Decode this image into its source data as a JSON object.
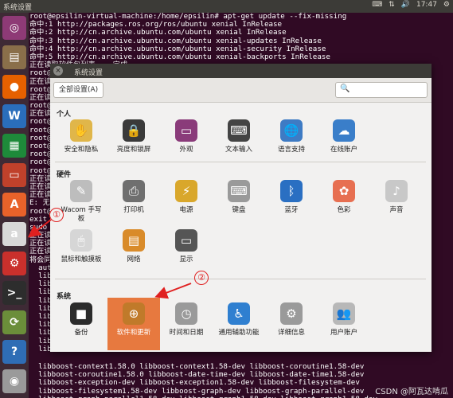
{
  "topbar": {
    "title": "系统设置",
    "time": "17:47",
    "icons": [
      "keyboard-icon",
      "network-icon",
      "sound-icon",
      "power-icon"
    ]
  },
  "launcher": {
    "items": [
      {
        "name": "ubuntu-dash-icon",
        "color": "#8e3a76",
        "glyph": "◎"
      },
      {
        "name": "files-icon",
        "color": "#8a6f4a",
        "glyph": "▤"
      },
      {
        "name": "firefox-icon",
        "color": "#e66000",
        "glyph": "●"
      },
      {
        "name": "writer-icon",
        "color": "#2a6ebb",
        "glyph": "W"
      },
      {
        "name": "calc-icon",
        "color": "#1e8a3a",
        "glyph": "▦"
      },
      {
        "name": "impress-icon",
        "color": "#c0412b",
        "glyph": "▭"
      },
      {
        "name": "software-center-icon",
        "color": "#e8622a",
        "glyph": "A"
      },
      {
        "name": "amazon-icon",
        "color": "#d8d8d8",
        "glyph": "a"
      },
      {
        "name": "system-settings-icon",
        "color": "#c9302c",
        "glyph": "⚙"
      },
      {
        "name": "terminal-icon",
        "color": "#2d2d2d",
        "glyph": ">_"
      },
      {
        "name": "software-updater-icon",
        "color": "#6b8e3a",
        "glyph": "⟳"
      },
      {
        "name": "help-icon",
        "color": "#2f6db5",
        "glyph": "?"
      },
      {
        "name": "dvd-icon",
        "color": "#9a9a9a",
        "glyph": "◉"
      }
    ]
  },
  "terminal": {
    "lines": [
      "root@epsilin-virtual-machine:/home/epsilin# apt-get update --fix-missing",
      "命中:1 http://packages.ros.org/ros/ubuntu xenial InRelease",
      "命中:2 http://cn.archive.ubuntu.com/ubuntu xenial InRelease",
      "命中:3 http://cn.archive.ubuntu.com/ubuntu xenial-updates InRelease",
      "命中:4 http://cn.archive.ubuntu.com/ubuntu xenial-security InRelease",
      "命中:5 http://cn.archive.ubuntu.com/ubuntu xenial-backports InRelease",
      "正在读取软件包列表... 完成",
      "root@",
      "正在读",
      "root@",
      "正在读",
      "root@",
      "正在读",
      "root@",
      "root@",
      "root@",
      "root@",
      "root@",
      "root@",
      "root@",
      "正在读",
      "正在读",
      "正在读",
      "E: 无法",
      "root@",
      "exit",
      "sudo",
      "正在读",
      "正在读",
      "正在读",
      "将会同",
      "  aut",
      "  lib",
      "  lib",
      "  lib",
      "  lib",
      "  lib",
      "  lib",
      "  lib",
      "  lib",
      "  lib",
      "  lib"
    ],
    "bottom_lines": [
      "  libboost-context1.58.0 libboost-context1.58-dev libboost-coroutine1.58-dev",
      "  libboost-coroutine1.58.0 libboost-date-time-dev libboost-date-time1.58-dev",
      "  libboost-exception-dev libboost-exception1.58-dev libboost-filesystem-dev",
      "  libboost-filesystem1.58-dev libboost-graph-dev libboost-graph-parallel-dev",
      "  libboost-graph-parallel1.58-dev libboost-graph1.58-dev libboost-graph1.58-dev"
    ],
    "watermark": "CSDN @阿瓦达啃瓜"
  },
  "dialog": {
    "title": "系统设置",
    "all_settings": "全部设置(A)",
    "search_placeholder": "",
    "sections": {
      "personal": {
        "title": "个人",
        "items": [
          {
            "label": "安全和隐私",
            "icon": "privacy-icon",
            "color": "#e0b64a",
            "glyph": "✋"
          },
          {
            "label": "亮度和锁屏",
            "icon": "lock-screen-icon",
            "color": "#3a3a3a",
            "glyph": "🔒"
          },
          {
            "label": "外观",
            "icon": "appearance-icon",
            "color": "#8a3b7a",
            "glyph": "▭"
          },
          {
            "label": "文本输入",
            "icon": "text-entry-icon",
            "color": "#444",
            "glyph": "⌨"
          },
          {
            "label": "语言支持",
            "icon": "language-icon",
            "color": "#3e7bc4",
            "glyph": "🌐"
          },
          {
            "label": "在线账户",
            "icon": "online-accounts-icon",
            "color": "#3a7ec9",
            "glyph": "☁"
          }
        ]
      },
      "hardware": {
        "title": "硬件",
        "items": [
          {
            "label": "Wacom 手写\n板",
            "icon": "wacom-icon",
            "color": "#bdbdbd",
            "glyph": "✎"
          },
          {
            "label": "打印机",
            "icon": "printer-icon",
            "color": "#6f6f6f",
            "glyph": "⎙"
          },
          {
            "label": "电源",
            "icon": "power-icon",
            "color": "#d9a72b",
            "glyph": "⚡"
          },
          {
            "label": "键盘",
            "icon": "keyboard-icon",
            "color": "#9a9a9a",
            "glyph": "⌨"
          },
          {
            "label": "蓝牙",
            "icon": "bluetooth-icon",
            "color": "#2a6fc2",
            "glyph": "ᛒ"
          },
          {
            "label": "色彩",
            "icon": "color-icon",
            "color": "#e76f51",
            "glyph": "✿"
          },
          {
            "label": "声音",
            "icon": "sound-icon",
            "color": "#c8c8c8",
            "glyph": "♪"
          }
        ]
      },
      "hardware2": {
        "items": [
          {
            "label": "鼠标和触摸板",
            "icon": "mouse-icon",
            "color": "#d6d6d6",
            "glyph": "🖱"
          },
          {
            "label": "网络",
            "icon": "network-icon",
            "color": "#d98b2a",
            "glyph": "▤"
          },
          {
            "label": "显示",
            "icon": "display-icon",
            "color": "#555",
            "glyph": "▭"
          }
        ]
      },
      "system": {
        "title": "系统",
        "items": [
          {
            "label": "备份",
            "icon": "backup-icon",
            "color": "#2b2b2b",
            "glyph": "■"
          },
          {
            "label": "软件和更新",
            "icon": "software-updates-icon",
            "color": "#c07a2a",
            "glyph": "⊕"
          },
          {
            "label": "时间和日期",
            "icon": "clock-icon",
            "color": "#9a9a9a",
            "glyph": "◷"
          },
          {
            "label": "通用辅助功能",
            "icon": "accessibility-icon",
            "color": "#2f7fd0",
            "glyph": "♿"
          },
          {
            "label": "详细信息",
            "icon": "details-icon",
            "color": "#9a9a9a",
            "glyph": "⚙"
          },
          {
            "label": "用户账户",
            "icon": "user-accounts-icon",
            "color": "#b8b8b8",
            "glyph": "👥"
          }
        ]
      }
    }
  },
  "annotations": {
    "one": "①",
    "two": "②",
    "accent": "#e02020",
    "selected": "#e7793f"
  }
}
